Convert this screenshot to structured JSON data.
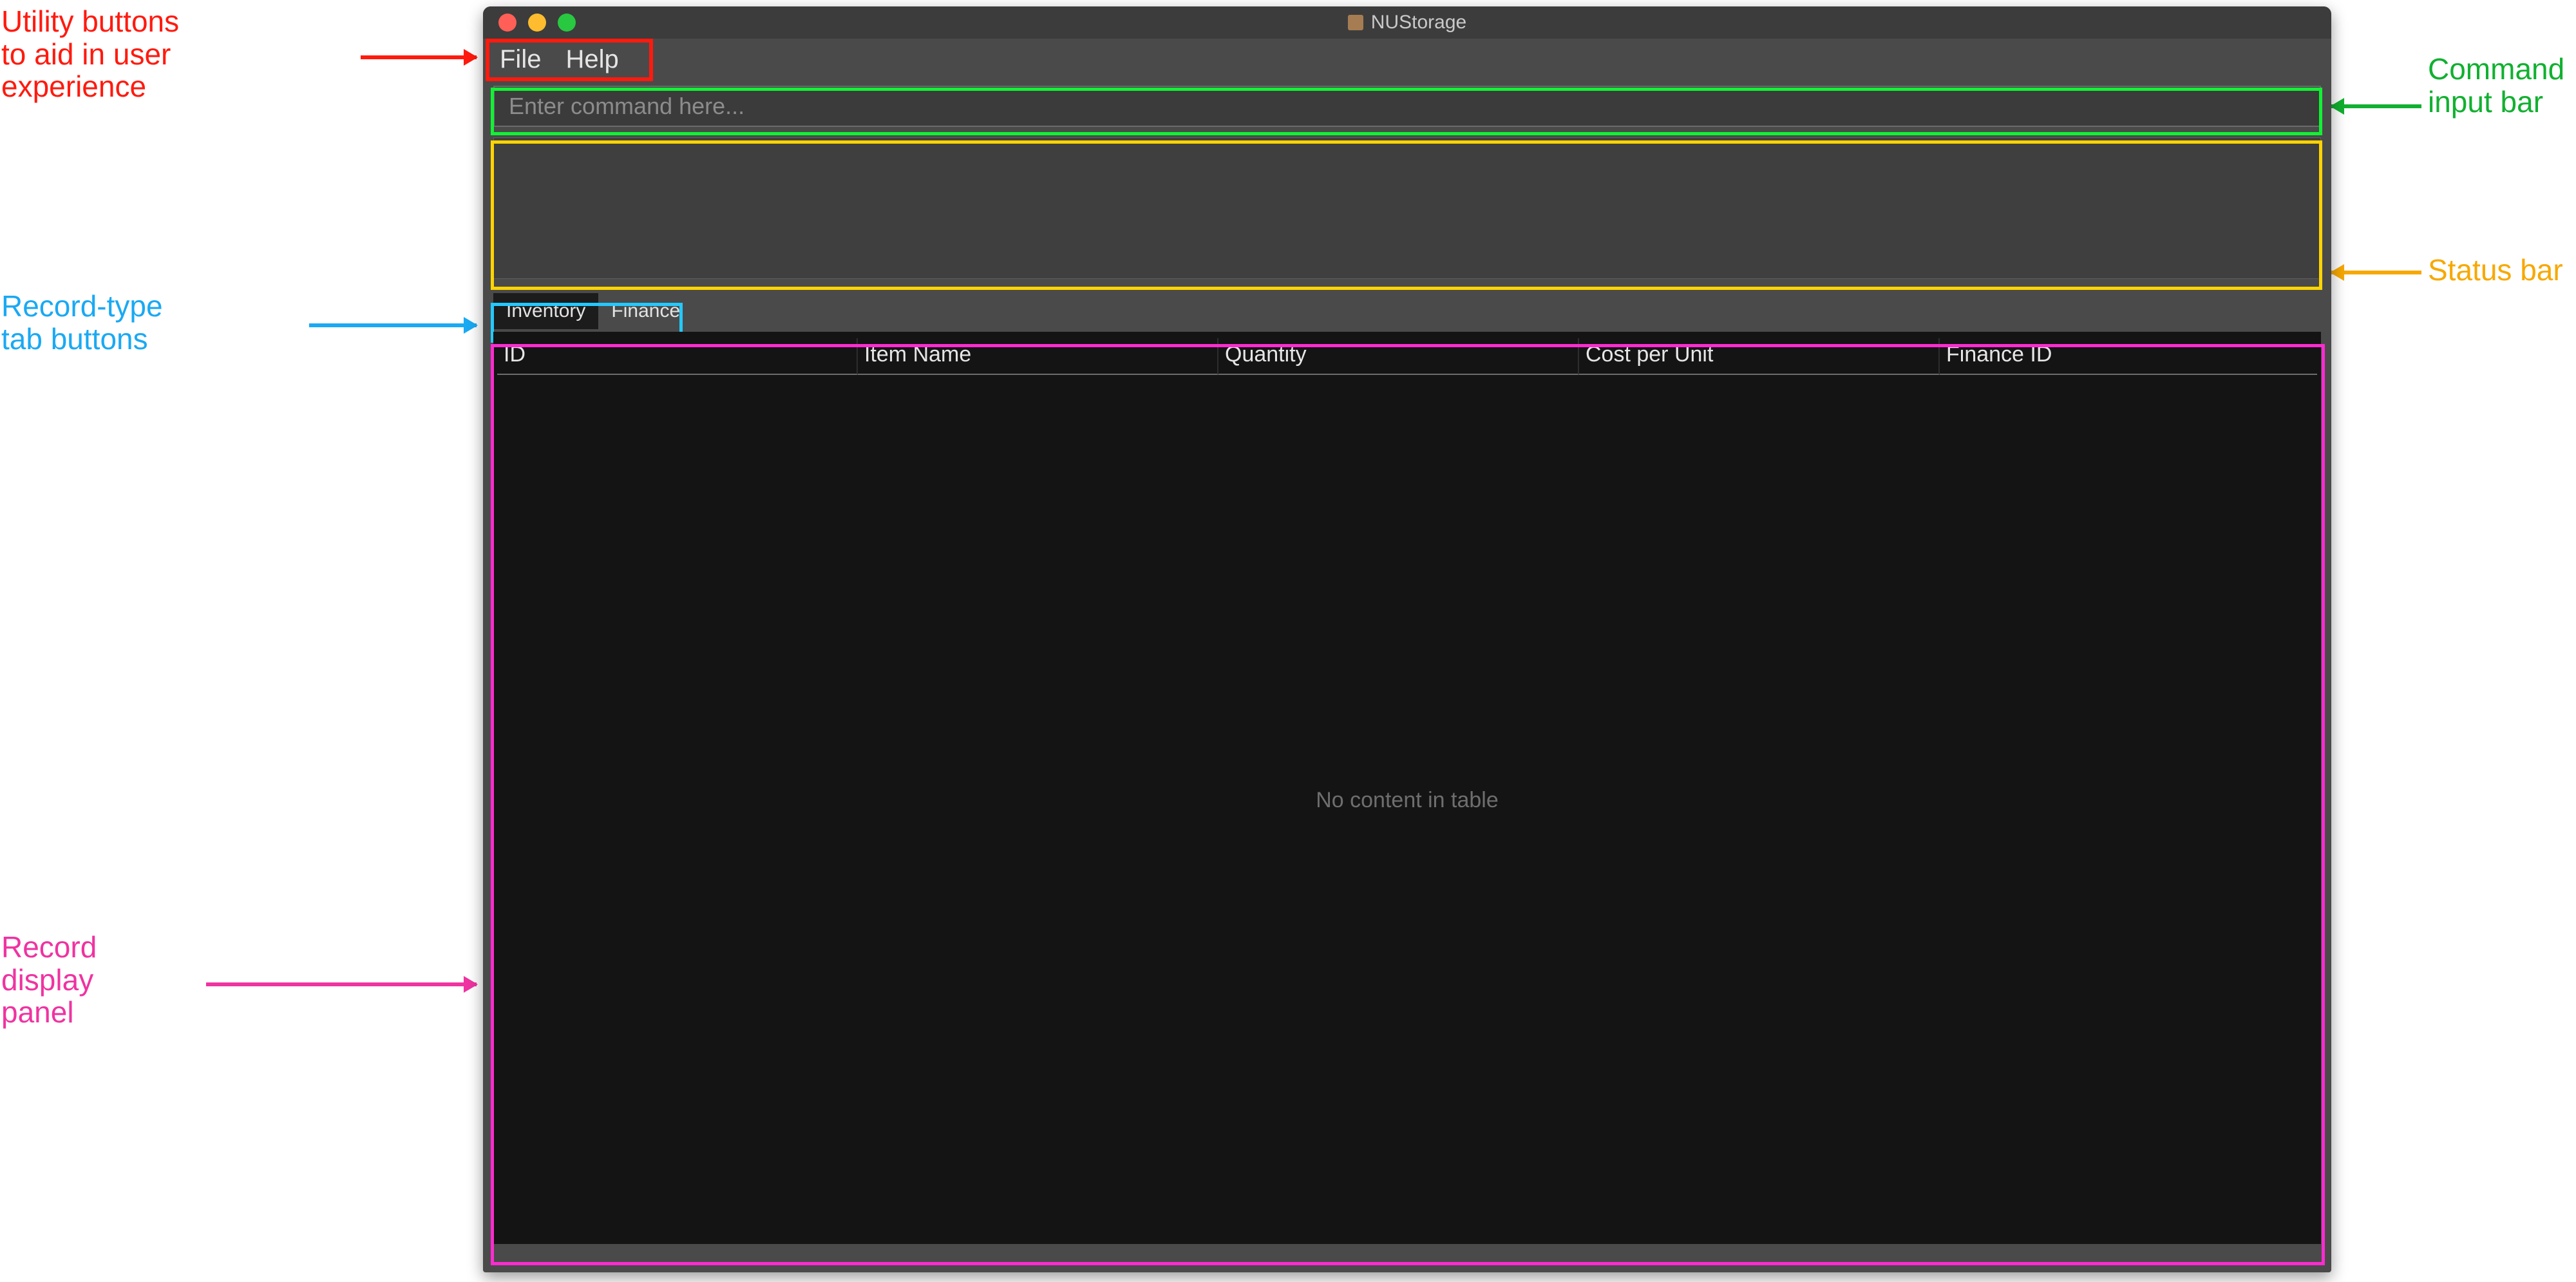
{
  "annotations": {
    "utility_label_line1": "Utility buttons",
    "utility_label_line2": "to aid in user",
    "utility_label_line3": "experience",
    "tab_label_line1": "Record-type",
    "tab_label_line2": "tab buttons",
    "display_label_line1": "Record",
    "display_label_line2": "display",
    "display_label_line3": "panel",
    "command_label_line1": "Command",
    "command_label_line2": "input bar",
    "status_label": "Status bar",
    "colors": {
      "red": "#ff1a0e",
      "blue": "#1aa9f3",
      "magenta": "#ef33a1",
      "green": "#11b030",
      "orange": "#f7a800",
      "highlight_green": "#11f233",
      "highlight_yellow": "#ffd400",
      "highlight_cyan": "#23c9ff",
      "highlight_pink": "#ff2bd0"
    }
  },
  "window": {
    "title": "NUStorage"
  },
  "menu": {
    "items": [
      "File",
      "Help"
    ]
  },
  "command": {
    "placeholder": "Enter command here...",
    "value": ""
  },
  "status": {
    "text": ""
  },
  "tabs": {
    "items": [
      {
        "label": "Inventory",
        "active": true
      },
      {
        "label": "Finance",
        "active": false
      }
    ]
  },
  "table": {
    "columns": [
      "ID",
      "Item Name",
      "Quantity",
      "Cost per Unit",
      "Finance ID"
    ],
    "rows": [],
    "empty_message": "No content in table"
  }
}
